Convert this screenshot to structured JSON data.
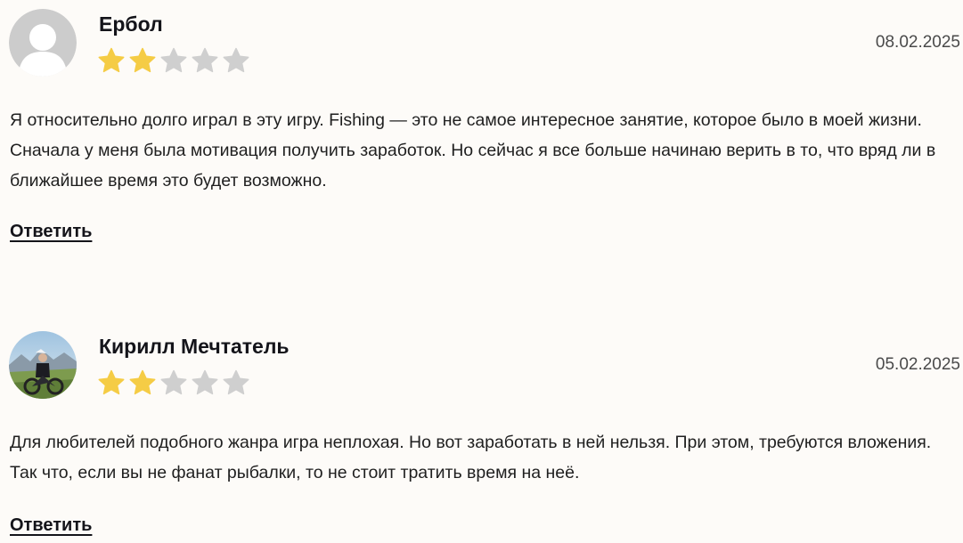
{
  "reviews": [
    {
      "author": "Ербол",
      "date": "08.02.2025",
      "rating": 2,
      "max_rating": 5,
      "avatar": "default-user-icon",
      "text": "Я относительно долго играл в эту игру. Fishing — это не самое интересное занятие, которое было в моей жизни. Сначала у меня была мотивация получить заработок. Но сейчас я все больше начинаю верить в то, что вряд ли в ближайшее время это будет возможно.",
      "reply_label": "Ответить"
    },
    {
      "author": "Кирилл Мечтатель",
      "date": "05.02.2025",
      "rating": 2,
      "max_rating": 5,
      "avatar": "user-photo",
      "text": "Для любителей подобного жанра игра неплохая. Но вот заработать в ней нельзя. При этом, требуются вложения. Так что, если вы не фанат рыбалки, то не стоит тратить время на неё.",
      "reply_label": "Ответить"
    }
  ],
  "colors": {
    "star_filled": "#f5cc45",
    "star_empty": "#cfcfcf",
    "background": "#fdfbf8"
  }
}
